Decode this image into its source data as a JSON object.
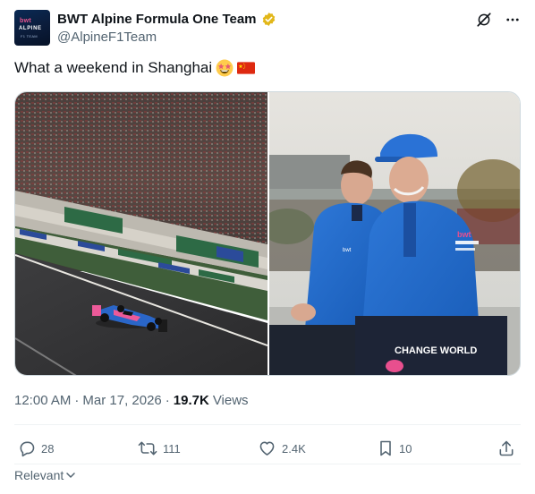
{
  "author": {
    "display_name": "BWT Alpine Formula One Team",
    "handle": "@AlpineF1Team",
    "avatar_text": {
      "top": "bwt",
      "mid": "ALPINE",
      "bot": "F1 TEAM"
    },
    "verified": true
  },
  "tweet": {
    "text": "What a weekend in Shanghai",
    "emojis": [
      "star-struck-emoji",
      "china-flag-emoji"
    ]
  },
  "media": {
    "photo_count": 2,
    "left_photo": "race-car-on-track",
    "right_photo": "drivers-sitting-on-wall",
    "shirt_text": "bwt",
    "shorts_text": "CHANGE WORLD"
  },
  "meta": {
    "time": "12:00 AM",
    "separator": "·",
    "date": "Mar 17, 2026",
    "views_count": "19.7K",
    "views_label": "Views"
  },
  "actions": {
    "replies": "28",
    "reposts": "111",
    "likes": "2.4K",
    "bookmarks": "10"
  },
  "sort": {
    "label": "Relevant"
  },
  "colors": {
    "text": "#0f1419",
    "secondary": "#536471",
    "verified_gold": "#e2b719",
    "alpine_blue": "#1f64c8",
    "alpine_pink": "#e84f8e"
  }
}
